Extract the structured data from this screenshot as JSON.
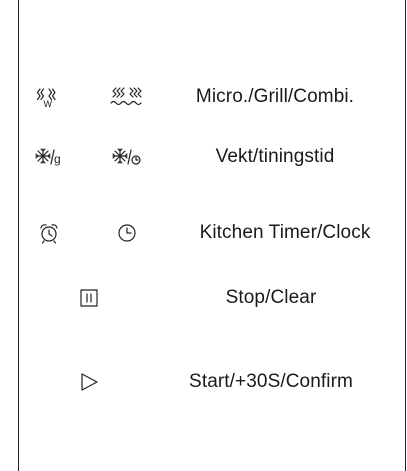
{
  "rows": [
    {
      "label": "Micro./Grill/Combi.",
      "icons": [
        "microwave-w-icon",
        "grill-wave-icon"
      ],
      "icon_text": "W"
    },
    {
      "label": "Vekt/tiningstid",
      "icons": [
        "defrost-weight-icon",
        "defrost-time-icon"
      ],
      "icon_text": "g"
    },
    {
      "label": "Kitchen Timer/Clock",
      "icons": [
        "alarm-clock-icon",
        "clock-icon"
      ]
    },
    {
      "label": "Stop/Clear",
      "icons": [
        "pause-icon"
      ]
    },
    {
      "label": "Start/+30S/Confirm",
      "icons": [
        "play-icon"
      ]
    }
  ]
}
